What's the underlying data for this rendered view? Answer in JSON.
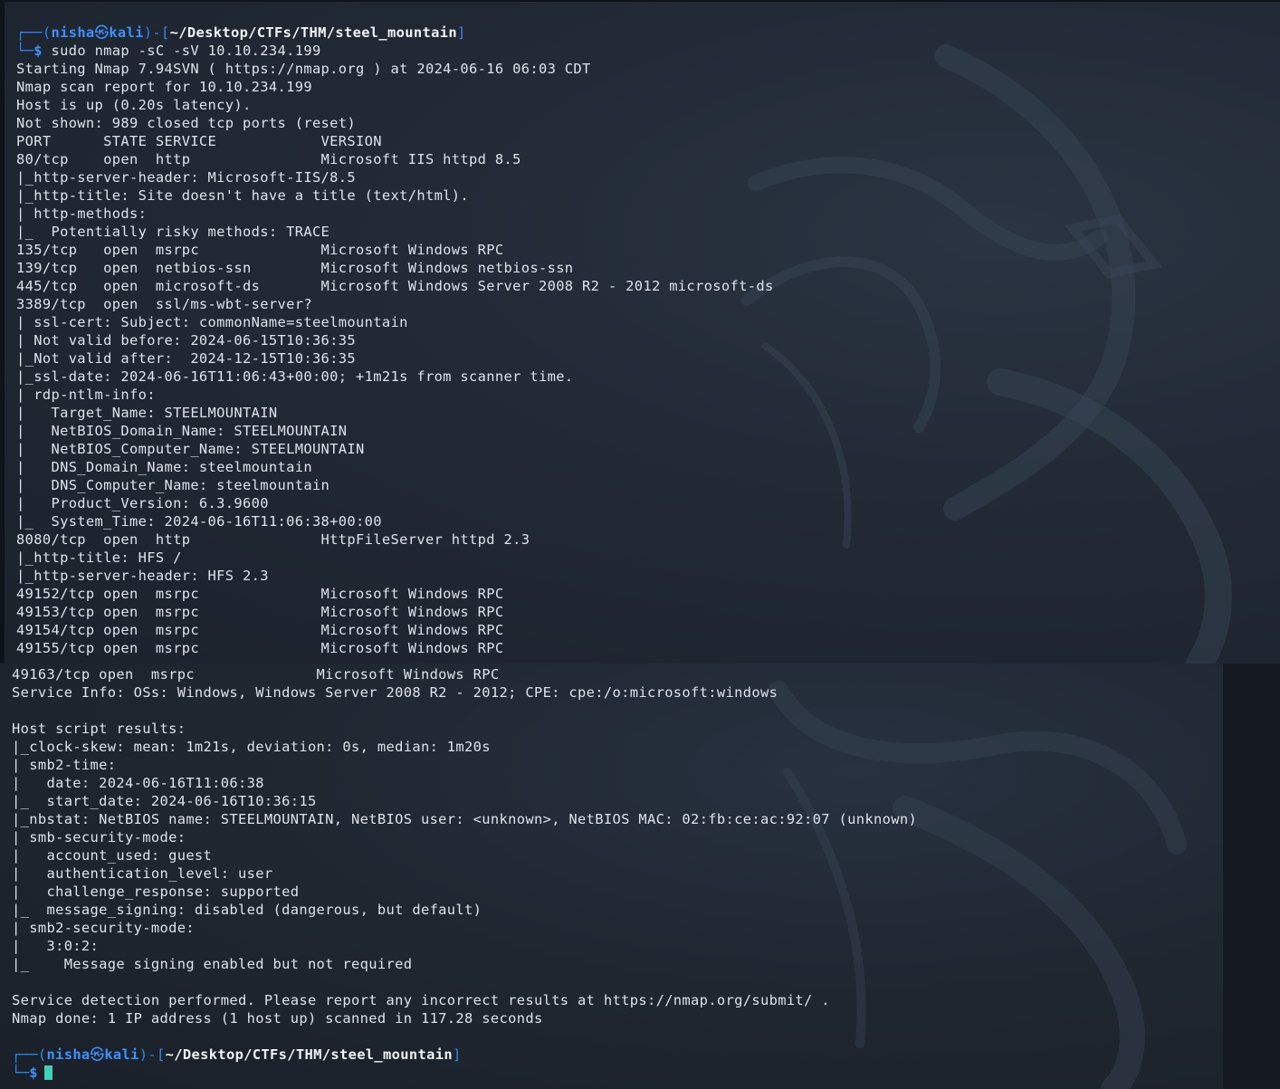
{
  "prompt": {
    "user": "nisha",
    "host": "kali",
    "cwd": "~/Desktop/CTFs/THM/steel_mountain",
    "symbol": "$",
    "command": "sudo nmap -sC -sV 10.10.234.199"
  },
  "top_output": [
    "Starting Nmap 7.94SVN ( https://nmap.org ) at 2024-06-16 06:03 CDT",
    "Nmap scan report for 10.10.234.199",
    "Host is up (0.20s latency).",
    "Not shown: 989 closed tcp ports (reset)",
    "PORT      STATE SERVICE            VERSION",
    "80/tcp    open  http               Microsoft IIS httpd 8.5",
    "|_http-server-header: Microsoft-IIS/8.5",
    "|_http-title: Site doesn't have a title (text/html).",
    "| http-methods:",
    "|_  Potentially risky methods: TRACE",
    "135/tcp   open  msrpc              Microsoft Windows RPC",
    "139/tcp   open  netbios-ssn        Microsoft Windows netbios-ssn",
    "445/tcp   open  microsoft-ds       Microsoft Windows Server 2008 R2 - 2012 microsoft-ds",
    "3389/tcp  open  ssl/ms-wbt-server?",
    "| ssl-cert: Subject: commonName=steelmountain",
    "| Not valid before: 2024-06-15T10:36:35",
    "|_Not valid after:  2024-12-15T10:36:35",
    "|_ssl-date: 2024-06-16T11:06:43+00:00; +1m21s from scanner time.",
    "| rdp-ntlm-info:",
    "|   Target_Name: STEELMOUNTAIN",
    "|   NetBIOS_Domain_Name: STEELMOUNTAIN",
    "|   NetBIOS_Computer_Name: STEELMOUNTAIN",
    "|   DNS_Domain_Name: steelmountain",
    "|   DNS_Computer_Name: steelmountain",
    "|   Product_Version: 6.3.9600",
    "|_  System_Time: 2024-06-16T11:06:38+00:00",
    "8080/tcp  open  http               HttpFileServer httpd 2.3",
    "|_http-title: HFS /",
    "|_http-server-header: HFS 2.3",
    "49152/tcp open  msrpc              Microsoft Windows RPC",
    "49153/tcp open  msrpc              Microsoft Windows RPC",
    "49154/tcp open  msrpc              Microsoft Windows RPC",
    "49155/tcp open  msrpc              Microsoft Windows RPC"
  ],
  "bottom_output": [
    "49163/tcp open  msrpc              Microsoft Windows RPC",
    "Service Info: OSs: Windows, Windows Server 2008 R2 - 2012; CPE: cpe:/o:microsoft:windows",
    "",
    "Host script results:",
    "|_clock-skew: mean: 1m21s, deviation: 0s, median: 1m20s",
    "| smb2-time:",
    "|   date: 2024-06-16T11:06:38",
    "|_  start_date: 2024-06-16T10:36:15",
    "|_nbstat: NetBIOS name: STEELMOUNTAIN, NetBIOS user: <unknown>, NetBIOS MAC: 02:fb:ce:ac:92:07 (unknown)",
    "| smb-security-mode:",
    "|   account_used: guest",
    "|   authentication_level: user",
    "|   challenge_response: supported",
    "|_  message_signing: disabled (dangerous, but default)",
    "| smb2-security-mode:",
    "|   3:0:2:",
    "|_    Message signing enabled but not required",
    "",
    "Service detection performed. Please report any incorrect results at https://nmap.org/submit/ .",
    "Nmap done: 1 IP address (1 host up) scanned in 117.28 seconds"
  ],
  "colors": {
    "background": "#1e2530",
    "text": "#dde3ea",
    "prompt_blue": "#3e90ff",
    "cursor": "#3fd0b8"
  }
}
